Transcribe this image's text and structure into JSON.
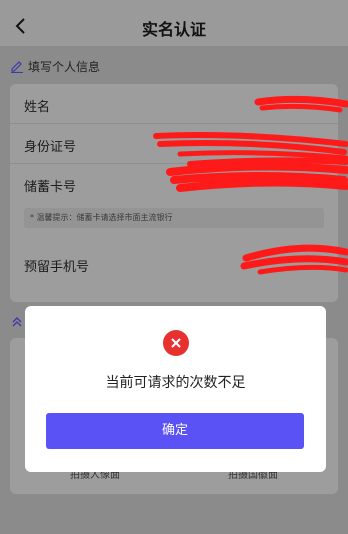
{
  "nav": {
    "title": "实名认证",
    "back_icon": "chevron-left-icon"
  },
  "section1": {
    "title": "填写个人信息",
    "icon": "pen-icon",
    "accent_color": "#5a52f5"
  },
  "form": {
    "fields": [
      {
        "label": "姓名"
      },
      {
        "label": "身份证号"
      },
      {
        "label": "储蓄卡号"
      },
      {
        "label": "预留手机号"
      }
    ],
    "hint": "* 温馨提示：储蓄卡请选择市面主流银行"
  },
  "section2": {
    "icon": "upload-icon",
    "left_label": "拍摄人像面",
    "right_label": "拍摄国徽面"
  },
  "dialog": {
    "icon": "error-icon",
    "message": "当前可请求的次数不足",
    "confirm_label": "确定",
    "error_color": "#e8312f",
    "button_color": "#5a52f5"
  }
}
